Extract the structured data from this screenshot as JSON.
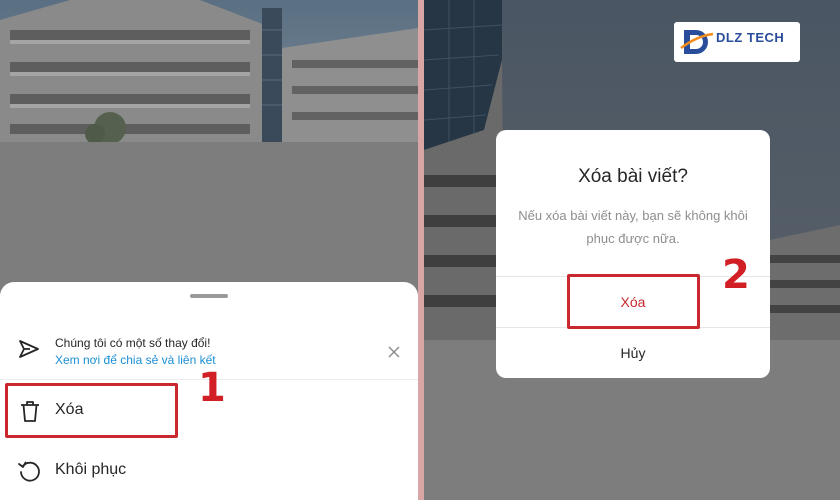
{
  "left": {
    "notice": {
      "title": "Chúng tôi có một số thay đổi!",
      "link": "Xem nơi để chia sẻ và liên kết"
    },
    "menu": [
      {
        "label": "Xóa",
        "icon": "trash-icon"
      },
      {
        "label": "Khôi phục",
        "icon": "restore-icon"
      }
    ],
    "step": "1"
  },
  "right": {
    "logo": {
      "text": "DLZ TECH"
    },
    "dialog": {
      "title": "Xóa bài viết?",
      "message": "Nếu xóa bài viết này, bạn sẽ không khôi phục được nữa.",
      "confirm_label": "Xóa",
      "cancel_label": "Hủy"
    },
    "step": "2"
  },
  "colors": {
    "highlight": "#c8282e",
    "step_number": "#d21f26",
    "link": "#1a8fd6",
    "confirm": "#c8282e",
    "overlay": "#7d7d7d"
  }
}
